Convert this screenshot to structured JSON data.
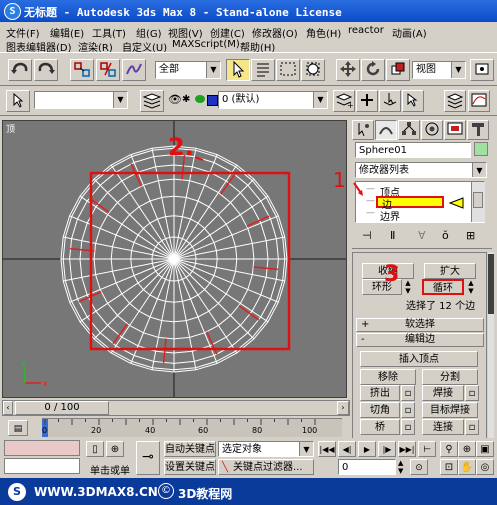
{
  "window": {
    "title": "无标题 - Autodesk 3ds Max 8 - Stand-alone License",
    "icon": "3dsmax-app-icon"
  },
  "menu": {
    "row1": [
      "文件(F)",
      "编辑(E)",
      "工具(T)",
      "组(G)",
      "视图(V)",
      "创建(C)",
      "修改器(O)",
      "角色(H)",
      "reactor",
      "动画(A)"
    ],
    "row2": [
      "图表编辑器(D)",
      "渲染(R)",
      "自定义(U)",
      "MAXScript(M)",
      "帮助(H)"
    ]
  },
  "toolbar1": {
    "selection_filter": "全部",
    "ref_coord": "视图"
  },
  "toolbar2": {
    "layer": "0 (默认)"
  },
  "viewport": {
    "label": "顶",
    "annotation_2": "2."
  },
  "panel": {
    "object_name": "Sphere01",
    "modifier_list": "修改器列表",
    "stack": [
      {
        "label": "顶点",
        "selected": false
      },
      {
        "label": "边",
        "selected": true
      },
      {
        "label": "边界",
        "selected": false
      }
    ],
    "annotation_1": "1",
    "annotation_3": "3",
    "shrink": "收缩",
    "grow": "扩大",
    "ring": "环形",
    "loop": "循环",
    "selection_info": "选择了 12 个边",
    "soft_selection": "软选择",
    "edit_edges": "编辑边",
    "insert_vertex": "插入顶点",
    "remove": "移除",
    "split": "分割",
    "extrude": "挤出",
    "weld": "焊接",
    "chamfer": "切角",
    "target_weld": "目标焊接",
    "bridge": "桥",
    "connect": "连接",
    "rollout_plus": "+",
    "rollout_minus": "-"
  },
  "timeline": {
    "slider": "0 / 100",
    "ticks": [
      "0",
      "20",
      "40",
      "60",
      "80",
      "100"
    ]
  },
  "bottom": {
    "auto_key": "自动关键点",
    "selected": "选定对象",
    "set_key": "设置关键点",
    "key_filters": "关键点过滤器...",
    "click_or": "单击或单",
    "frame": "0"
  },
  "watermark": {
    "text1": "WWW.3DMAX8.CN",
    "text2": "3D教程网"
  },
  "colors": {
    "titlebar": "#0a4cc8",
    "highlight": "#ffff00",
    "annotation": "#e01010"
  }
}
